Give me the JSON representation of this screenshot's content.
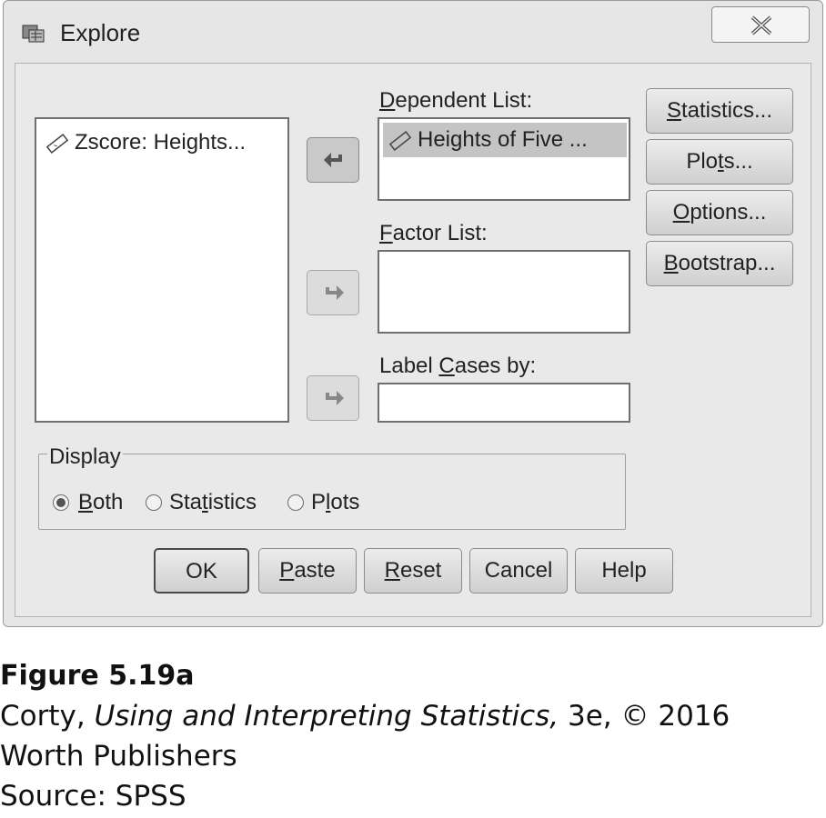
{
  "window": {
    "title": "Explore",
    "close_icon": "close-icon"
  },
  "variables": {
    "items": [
      "Zscore: Heights..."
    ]
  },
  "dependent_list": {
    "label_pre": "",
    "label_ul": "D",
    "label_post": "ependent List:",
    "items": [
      "Heights of Five ..."
    ]
  },
  "factor_list": {
    "label_ul": "F",
    "label_post": "actor List:"
  },
  "label_cases": {
    "label_pre": "Label ",
    "label_ul": "C",
    "label_post": "ases by:"
  },
  "side_buttons": {
    "statistics": {
      "pre": "",
      "ul": "S",
      "post": "tatistics..."
    },
    "plots": {
      "pre": "Plo",
      "ul": "t",
      "post": "s..."
    },
    "options": {
      "pre": "",
      "ul": "O",
      "post": "ptions..."
    },
    "bootstrap": {
      "pre": "",
      "ul": "B",
      "post": "ootstrap..."
    }
  },
  "display": {
    "legend": "Display",
    "options": [
      {
        "pre": "",
        "ul": "B",
        "post": "oth",
        "checked": true
      },
      {
        "pre": "Sta",
        "ul": "t",
        "post": "istics",
        "checked": false
      },
      {
        "pre": "P",
        "ul": "l",
        "post": "ots",
        "checked": false
      }
    ]
  },
  "bottom_buttons": {
    "ok": "OK",
    "paste": {
      "ul": "P",
      "post": "aste"
    },
    "reset": {
      "ul": "R",
      "post": "eset"
    },
    "cancel": "Cancel",
    "help": "Help"
  },
  "caption": {
    "figure": "Figure 5.19a",
    "line2_pre": "Corty, ",
    "line2_italic": "Using and Interpreting Statistics,",
    "line2_post": " 3e, © 2016",
    "line3": "Worth Publishers",
    "line4": "Source: SPSS"
  },
  "colors": {
    "dialog_bg": "#e6e6e6",
    "selection": "#c4c4c4"
  }
}
